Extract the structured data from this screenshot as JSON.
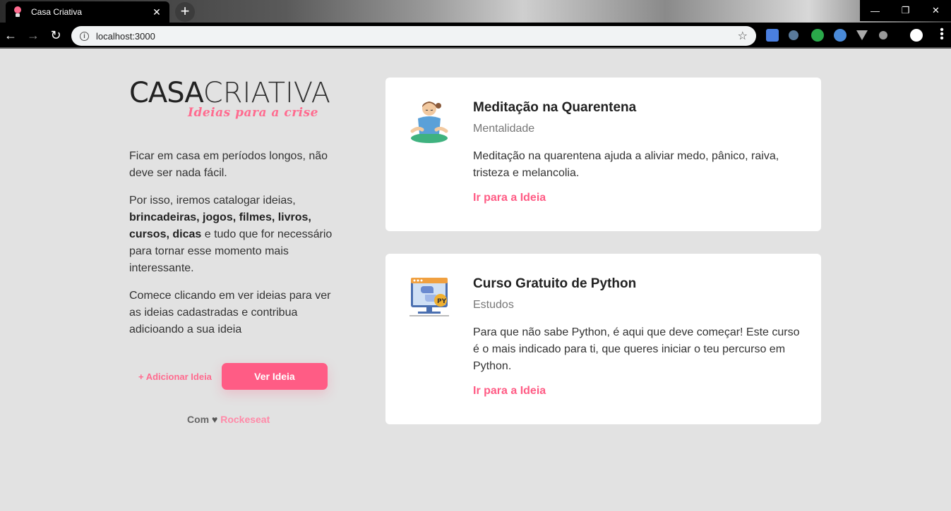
{
  "browser": {
    "tab_title": "Casa Criativa",
    "tab_close": "✕",
    "new_tab": "+",
    "url": "localhost:3000",
    "back": "←",
    "forward": "→",
    "reload": "↻",
    "star": "☆",
    "info": "i",
    "win_minimize": "—",
    "win_restore": "❐",
    "win_close": "✕"
  },
  "brand": {
    "logo_bold": "CASA",
    "logo_light": "CRIATIVA",
    "tagline": "Ideias para a crise",
    "accent_color": "#ff5c85"
  },
  "intro": {
    "p1": "Ficar em casa em períodos longos, não deve ser nada fácil.",
    "p2_start": "Por isso, iremos catalogar ideias,",
    "p2_bold": "brincadeiras, jogos, filmes, livros, cursos, dicas",
    "p2_end": " e tudo que for necessário para tornar esse momento mais interessante.",
    "p3": "Comece clicando em ver ideias para ver as ideias cadastradas e contribua adicioando a sua ideia"
  },
  "actions": {
    "add_label": "+ Adicionar Ideia",
    "view_label": "Ver Ideia"
  },
  "footer": {
    "prefix": "Com",
    "heart": "♥",
    "brand": "Rockeseat"
  },
  "ideas": [
    {
      "icon": "meditation-icon",
      "title": "Meditação na Quarentena",
      "category": "Mentalidade",
      "description": "Meditação na quarentena ajuda a aliviar medo, pânico, raiva, tristeza e melancolia.",
      "link": "Ir para a Ideia"
    },
    {
      "icon": "python-course-icon",
      "title": "Curso Gratuito de Python",
      "category": "Estudos",
      "description": "Para que não sabe Python, é aqui que deve começar! Este curso é o mais indicado para ti, que queres iniciar o teu percurso em Python.",
      "link": "Ir para a Ideia"
    }
  ]
}
